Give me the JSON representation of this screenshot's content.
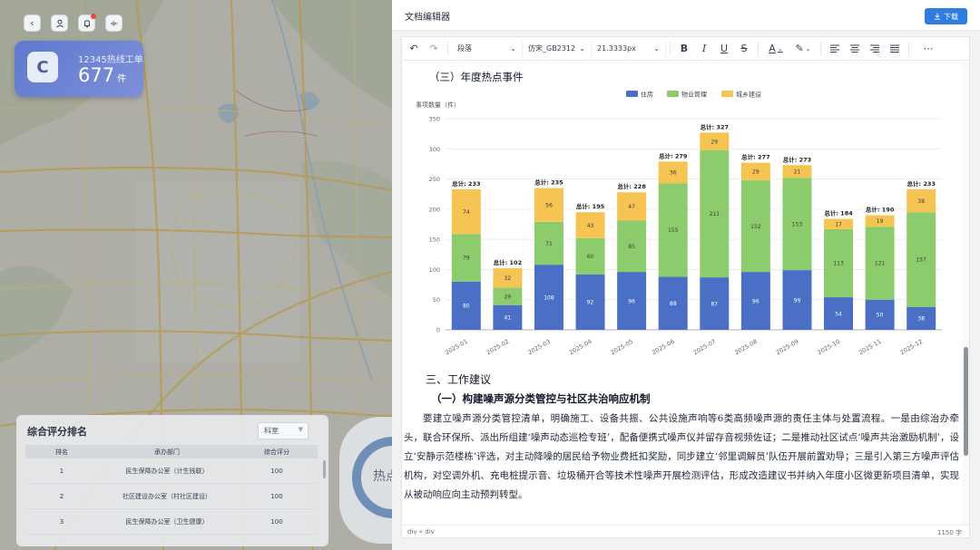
{
  "dashboard": {
    "hotline": {
      "label": "12345热线工单",
      "value": "677",
      "unit": "件"
    },
    "ranking": {
      "title": "综合评分排名",
      "filter": "科室",
      "columns": [
        "排名",
        "承办部门",
        "综合评分"
      ],
      "rows": [
        [
          "1",
          "民生保障办公室（计生残联）",
          "100"
        ],
        [
          "2",
          "社区建设办公室（村社区建设）",
          "100"
        ],
        [
          "3",
          "民生保障办公室（卫生健康）",
          "100"
        ]
      ]
    },
    "hot_label": "热点"
  },
  "editor": {
    "title": "文档编辑器",
    "download_label": "下载",
    "toolbar": {
      "block": "段落",
      "font": "仿宋_GB2312",
      "size": "21.3333px"
    },
    "heading": "（三）年度热点事件",
    "section_title": "三、工作建议",
    "subsection_title": "（一）构建噪声源分类管控与社区共治响应机制",
    "paragraph": "要建立噪声源分类管控清单，明确施工、设备共振、公共设施声响等6类高频噪声源的责任主体与处置流程。一是由综治办牵头，联合环保所、派出所组建‘噪声动态巡检专班’，配备便携式噪声仪并留存音视频佐证；二是推动社区试点‘噪声共治激励机制’，设立‘安静示范楼栋’评选，对主动降噪的居民给予物业费抵扣奖励，同步建立‘邻里调解员’队伍开展前置劝导；三是引入第三方噪声评估机构，对空调外机、充电桩提示音、垃圾桶开合等技术性噪声开展检测评估，形成改造建议书并纳入年度小区微更新项目清单，实现从被动响应向主动预判转型。",
    "status_path": "div » div",
    "word_count": "1150 字"
  },
  "chart_data": {
    "type": "bar",
    "stacked": true,
    "ylabel": "事项数量（件）",
    "ylim": [
      0,
      350
    ],
    "yticks": [
      0,
      50,
      100,
      150,
      200,
      250,
      300,
      350
    ],
    "categories": [
      "2025-01",
      "2025-02",
      "2025-03",
      "2025-04",
      "2025-05",
      "2025-06",
      "2025-07",
      "2025-08",
      "2025-09",
      "2025-10",
      "2025-11",
      "2025-12"
    ],
    "series": [
      {
        "name": "住房",
        "color": "#4a6fc4",
        "values": [
          80,
          41,
          108,
          92,
          96,
          88,
          87,
          96,
          99,
          54,
          50,
          38
        ]
      },
      {
        "name": "物业管理",
        "color": "#8dcc6c",
        "values": [
          79,
          29,
          71,
          60,
          85,
          155,
          211,
          152,
          153,
          113,
          121,
          157
        ]
      },
      {
        "name": "城乡建设",
        "color": "#f6c452",
        "values": [
          74,
          32,
          56,
          43,
          47,
          36,
          29,
          29,
          21,
          17,
          19,
          38
        ]
      }
    ],
    "total_prefix": "总计: ",
    "totals": [
      233,
      102,
      235,
      195,
      228,
      279,
      327,
      277,
      273,
      184,
      190,
      233
    ],
    "legend": "top-center",
    "grid": true
  }
}
